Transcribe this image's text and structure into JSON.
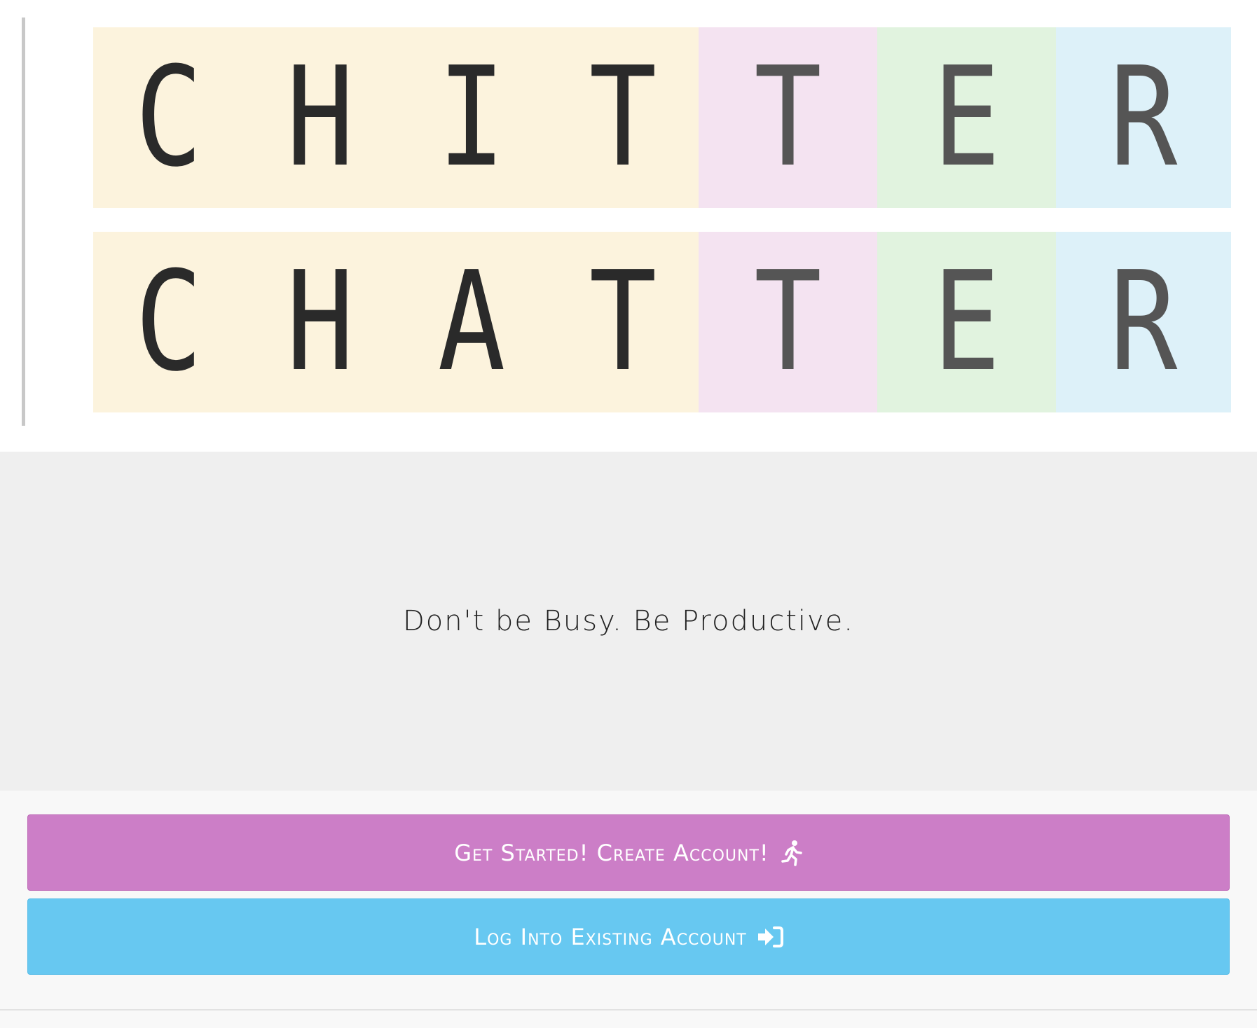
{
  "logo": {
    "row1": {
      "main": [
        "C",
        "H",
        "I",
        "T"
      ],
      "pink": "T",
      "green": "E",
      "blue": "R"
    },
    "row2": {
      "main": [
        "C",
        "H",
        "A",
        "T"
      ],
      "pink": "T",
      "green": "E",
      "blue": "R"
    }
  },
  "tagline": "Don't be Busy. Be Productive.",
  "buttons": {
    "create": {
      "label": "Get Started! Create Account!",
      "icon": "running-person-icon"
    },
    "login": {
      "label": "Log Into Existing Account",
      "icon": "sign-in-icon"
    }
  },
  "colors": {
    "create_button": "#cc7ec7",
    "login_button": "#67c8f1",
    "logo_main_bg": "#fcf3dd",
    "logo_pink_bg": "#f4e3f1",
    "logo_green_bg": "#e1f3df",
    "logo_blue_bg": "#ddf1f9",
    "tagline_band": "#efefef"
  }
}
